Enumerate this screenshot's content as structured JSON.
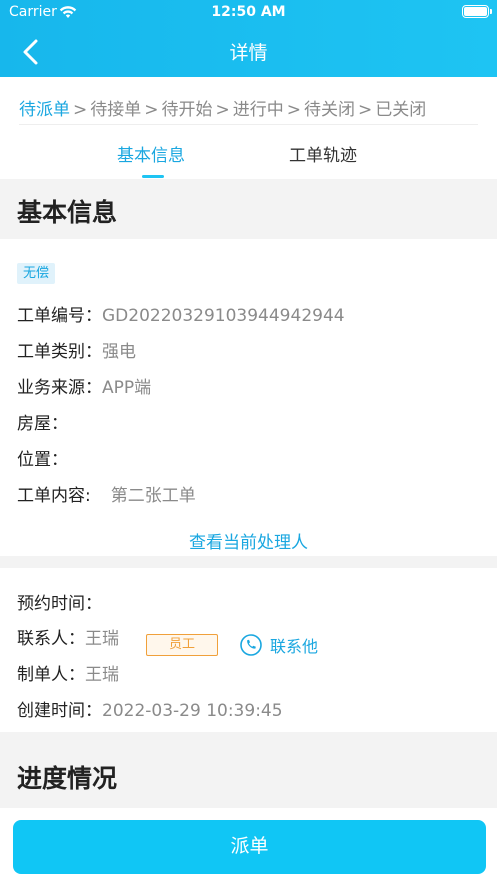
{
  "status_bar": {
    "carrier": "Carrier",
    "time": "12:50 AM"
  },
  "nav": {
    "title": "详情"
  },
  "steps": [
    {
      "label": "待派单",
      "active": true
    },
    {
      "label": "待接单",
      "active": false
    },
    {
      "label": "待开始",
      "active": false
    },
    {
      "label": "进行中",
      "active": false
    },
    {
      "label": "待关闭",
      "active": false
    },
    {
      "label": "已关闭",
      "active": false
    }
  ],
  "step_separator": ">",
  "tabs": [
    {
      "label": "基本信息",
      "active": true
    },
    {
      "label": "工单轨迹",
      "active": false
    }
  ],
  "basic": {
    "section_title": "基本信息",
    "badge": "无偿",
    "order_no_label": "工单编号：",
    "order_no": "GD20220329103944942944",
    "category_label": "工单类别：",
    "category": "强电",
    "source_label": "业务来源：",
    "source": "APP端",
    "house_label": "房屋：",
    "location_label": "位置：",
    "content_label": "工单内容:",
    "content": "第二张工单",
    "view_handler": "查看当前处理人"
  },
  "contact": {
    "appointment_label": "预约时间：",
    "contact_label": "联系人：",
    "contact_name": "王瑞",
    "role_badge": "员工",
    "call_label": "联系他",
    "creator_label": "制单人：",
    "creator": "王瑞",
    "created_label": "创建时间：",
    "created_time": "2022-03-29 10:39:45"
  },
  "progress_section": {
    "title": "进度情况"
  },
  "actions": {
    "dispatch": "派单"
  },
  "colors": {
    "accent": "#1aa7e0",
    "header": "#17b7ec",
    "button": "#10c6f5",
    "staff_badge": "#f0a03a"
  }
}
